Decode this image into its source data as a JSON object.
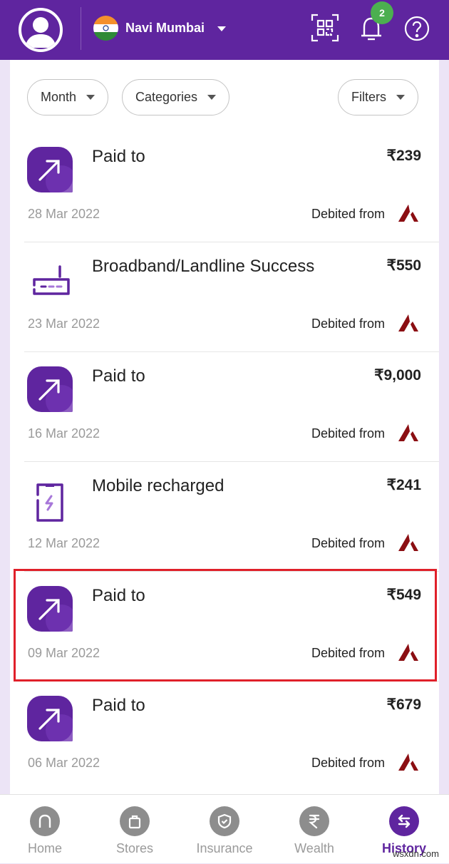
{
  "header": {
    "city": "Navi Mumbai",
    "notification_count": "2",
    "colors": {
      "brand": "#5f259f",
      "badge": "#4caf50"
    }
  },
  "filters": [
    {
      "label": "Month"
    },
    {
      "label": "Categories"
    },
    {
      "label": "Filters"
    }
  ],
  "transactions": [
    {
      "icon": "paid-arrow",
      "title": "Paid to",
      "amount": "₹239",
      "date": "28 Mar 2022",
      "debit_label": "Debited from",
      "bank": "axis-bank-logo"
    },
    {
      "icon": "router",
      "title": "Broadband/Landline Success",
      "amount": "₹550",
      "date": "23 Mar 2022",
      "debit_label": "Debited from",
      "bank": "axis-bank-logo"
    },
    {
      "icon": "paid-arrow",
      "title": "Paid to",
      "amount": "₹9,000",
      "date": "16 Mar 2022",
      "debit_label": "Debited from",
      "bank": "axis-bank-logo"
    },
    {
      "icon": "mobile-recharge",
      "title": "Mobile recharged",
      "amount": "₹241",
      "date": "12 Mar 2022",
      "debit_label": "Debited from",
      "bank": "axis-bank-logo"
    },
    {
      "icon": "paid-arrow",
      "title": "Paid to",
      "amount": "₹549",
      "date": "09 Mar 2022",
      "debit_label": "Debited from",
      "bank": "axis-bank-logo",
      "highlighted": true
    },
    {
      "icon": "paid-arrow",
      "title": "Paid to",
      "amount": "₹679",
      "date": "06 Mar 2022",
      "debit_label": "Debited from",
      "bank": "axis-bank-logo"
    }
  ],
  "bottom_nav": [
    {
      "label": "Home",
      "icon": "home-icon"
    },
    {
      "label": "Stores",
      "icon": "bag-icon"
    },
    {
      "label": "Insurance",
      "icon": "shield-icon"
    },
    {
      "label": "Wealth",
      "icon": "rupee-icon"
    },
    {
      "label": "History",
      "icon": "swap-arrows-icon",
      "active": true
    }
  ],
  "watermark": "wsxdn.com"
}
